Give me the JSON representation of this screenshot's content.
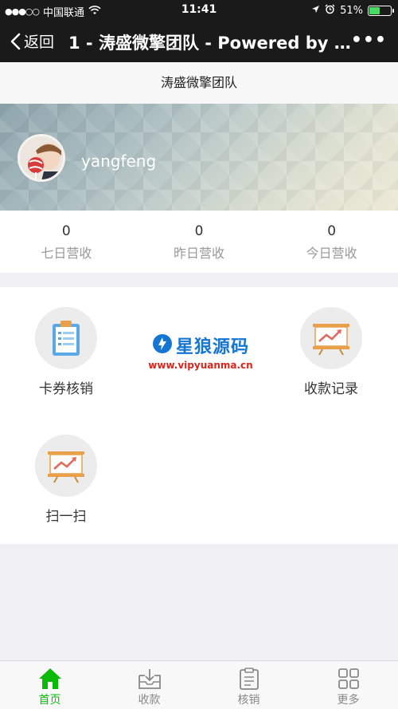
{
  "status_bar": {
    "carrier": "中国联通",
    "time": "11:41",
    "battery": "51%",
    "battery_level": 0.51
  },
  "nav": {
    "back_label": "返回",
    "title": "1 - 涛盛微擎团队 - Powered by W...",
    "more": "•••"
  },
  "page": {
    "header_title": "涛盛微擎团队"
  },
  "profile": {
    "username": "yangfeng"
  },
  "stats": [
    {
      "value": "0",
      "label": "七日营收"
    },
    {
      "value": "0",
      "label": "昨日营收"
    },
    {
      "value": "0",
      "label": "今日营收"
    }
  ],
  "grid": [
    {
      "label": "卡券核销",
      "icon": "clipboard-icon"
    },
    {
      "label": "收款记录",
      "icon": "presentation-chart-icon"
    },
    {
      "label": "扫一扫",
      "icon": "presentation-chart-icon"
    }
  ],
  "watermark": {
    "title": "星狼源码",
    "url": "www.vipyuanma.cn"
  },
  "tabs": [
    {
      "label": "首页",
      "icon": "home-icon",
      "active": true
    },
    {
      "label": "收款",
      "icon": "inbox-download-icon",
      "active": false
    },
    {
      "label": "核销",
      "icon": "clipboard-icon",
      "active": false
    },
    {
      "label": "更多",
      "icon": "grid-icon",
      "active": false
    }
  ],
  "colors": {
    "accent": "#09bb07",
    "nav_bg": "#1a1a1a",
    "icon_orange": "#e8a04b",
    "icon_blue": "#5aa9e6"
  }
}
